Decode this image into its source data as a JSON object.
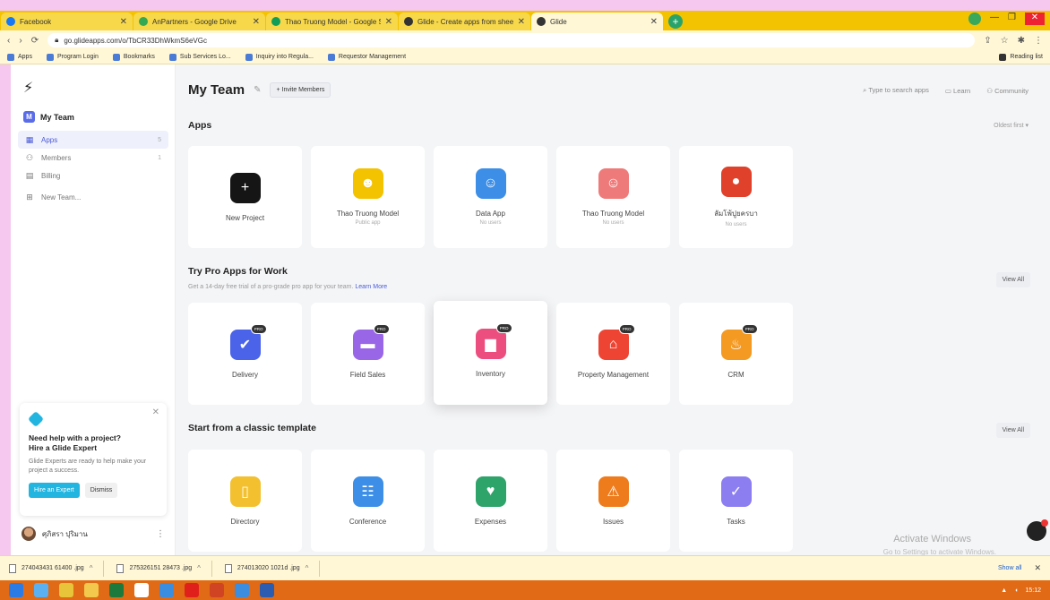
{
  "browser": {
    "tabs": [
      {
        "label": "Facebook",
        "color": "#1877f2",
        "active": false
      },
      {
        "label": "AnPartners - Google Drive",
        "color": "#34a853",
        "active": false
      },
      {
        "label": "Thao Truong Model - Google Sheets",
        "color": "#0f9d58",
        "active": false
      },
      {
        "label": "Glide - Create apps from sheets",
        "color": "#333333",
        "active": false
      },
      {
        "label": "Glide",
        "color": "#333333",
        "active": true
      }
    ],
    "url": "go.glideapps.com/o/TbCR33DhWkmS6eVGc",
    "bookmarks": [
      "Apps",
      "Program Login",
      "Bookmarks",
      "Sub Services Lo...",
      "Inquiry into Regula...",
      "Requestor Management"
    ],
    "bookmark_right": "Reading list"
  },
  "sidebar": {
    "logo": "⚡",
    "team": {
      "badge": "M",
      "name": "My Team"
    },
    "items": [
      {
        "icon": "▦",
        "label": "Apps",
        "count": "5"
      },
      {
        "icon": "⚇",
        "label": "Members",
        "count": "1"
      },
      {
        "icon": "▤",
        "label": "Billing",
        "count": ""
      }
    ],
    "new_team": "New Team..."
  },
  "help_card": {
    "title_line1": "Need help with a project?",
    "title_line2": "Hire a Glide Expert",
    "body": "Glide Experts are ready to help make your project a success.",
    "primary": "Hire an Expert",
    "dismiss": "Dismiss",
    "accent": "#22b5e0"
  },
  "user": {
    "name": "ศุภิสรา ปุริมาน"
  },
  "header": {
    "title": "My Team",
    "invite": "+ Invite Members",
    "search_placeholder": "Type to search apps",
    "learn": "Learn",
    "community": "Community"
  },
  "apps_section": {
    "title": "Apps",
    "sort": "Oldest first ▾",
    "cards": [
      {
        "name": "New Project",
        "sub": "",
        "color": "#151515",
        "glyph": "+"
      },
      {
        "name": "Thao Truong Model",
        "sub": "Public app",
        "color": "#f3c200",
        "glyph": "☻"
      },
      {
        "name": "Data App",
        "sub": "No users",
        "color": "#3d8ee6",
        "glyph": "☺"
      },
      {
        "name": "Thao Truong Model",
        "sub": "No users",
        "color": "#ef7a7a",
        "glyph": "☺"
      },
      {
        "name": "ลัมโพ้ปูยครบา",
        "sub": "No users",
        "color": "#e0412a",
        "glyph": "●"
      }
    ]
  },
  "pro_section": {
    "title": "Try Pro Apps for Work",
    "subtitle": "Get a 14-day free trial of a pro-grade pro app for your team.",
    "link": "Learn More",
    "view_all": "View All",
    "badge": "PRO",
    "cards": [
      {
        "name": "Delivery",
        "color": "#4a63e8",
        "glyph": "✔"
      },
      {
        "name": "Field Sales",
        "color": "#9966e8",
        "glyph": "▬"
      },
      {
        "name": "Inventory",
        "color": "#ec4f7f",
        "glyph": "▆"
      },
      {
        "name": "Property Management",
        "color": "#ee4433",
        "glyph": "⌂"
      },
      {
        "name": "CRM",
        "color": "#f49a22",
        "glyph": "♨"
      }
    ]
  },
  "template_section": {
    "title": "Start from a classic template",
    "view_all": "View All",
    "cards": [
      {
        "name": "Directory",
        "color": "#f3c030",
        "glyph": "▯"
      },
      {
        "name": "Conference",
        "color": "#3d8ee6",
        "glyph": "☷"
      },
      {
        "name": "Expenses",
        "color": "#2ea36a",
        "glyph": "♥"
      },
      {
        "name": "Issues",
        "color": "#ee7b1c",
        "glyph": "⚠"
      },
      {
        "name": "Tasks",
        "color": "#8c7ef0",
        "glyph": "✓"
      }
    ]
  },
  "watermark": {
    "line1": "Activate Windows",
    "line2": "Go to Settings to activate Windows."
  },
  "downloads": {
    "items": [
      "274043431 61400 .jpg",
      "275326151 28473 .jpg",
      "274013020 1021d .jpg"
    ],
    "show_all": "Show all"
  },
  "taskbar": {
    "icons": [
      {
        "name": "windows-start-icon",
        "color": "#2c7be5"
      },
      {
        "name": "ie-icon",
        "color": "#5ab0f0"
      },
      {
        "name": "chrome-icon",
        "color": "#e8c43a"
      },
      {
        "name": "file-explorer-icon",
        "color": "#f2c94c"
      },
      {
        "name": "excel-icon",
        "color": "#1d7a3c"
      },
      {
        "name": "notepad-icon",
        "color": "#ffffff"
      },
      {
        "name": "chrome2-icon",
        "color": "#3c8ce0"
      },
      {
        "name": "opera-icon",
        "color": "#e0201b"
      },
      {
        "name": "powerpoint-icon",
        "color": "#d04423"
      },
      {
        "name": "chrome3-icon",
        "color": "#3c8ce0"
      },
      {
        "name": "word-icon",
        "color": "#2b5caf"
      }
    ],
    "time": "15:12"
  }
}
